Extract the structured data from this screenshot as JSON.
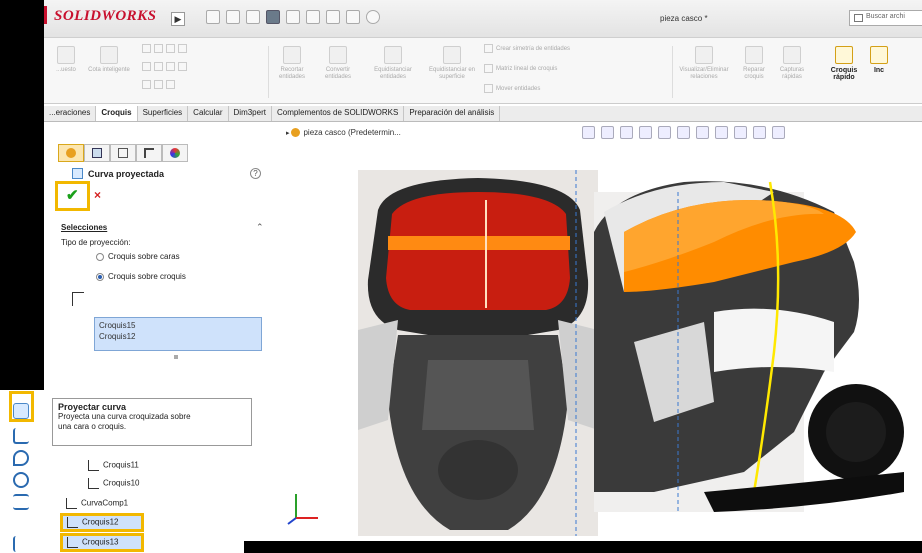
{
  "app": {
    "name": "SOLIDWORKS",
    "document_title": "pieza casco *",
    "search_placeholder": "Buscar archi"
  },
  "ribbon": {
    "buttons": [
      {
        "label": "...uesto"
      },
      {
        "label": "Cota inteligente"
      },
      {
        "label": "Recortar entidades"
      },
      {
        "label": "Convertir entidades"
      },
      {
        "label": "Equidistanciar entidades"
      },
      {
        "label": "Equidistanciar en superficie"
      },
      {
        "label": "Visualizar/Eliminar relaciones"
      },
      {
        "label": "Reparar croquis"
      },
      {
        "label": "Capturas rápidas"
      }
    ],
    "row_items": [
      "Crear simetría de entidades",
      "Matriz lineal de croquis",
      "Mover entidades"
    ],
    "active_button": {
      "line1": "Croquis",
      "line2": "rápido"
    },
    "cut_off_label": "Inc"
  },
  "tabs": [
    {
      "label": "...eraciones",
      "active": false
    },
    {
      "label": "Croquis",
      "active": true
    },
    {
      "label": "Superficies",
      "active": false
    },
    {
      "label": "Calcular",
      "active": false
    },
    {
      "label": "Dim3pert",
      "active": false
    },
    {
      "label": "Complementos de SOLIDWORKS",
      "active": false
    },
    {
      "label": "Preparación del análisis",
      "active": false
    }
  ],
  "property_manager": {
    "title": "Curva proyectada",
    "ok_symbol": "✔",
    "cancel_symbol": "×",
    "help_symbol": "?",
    "section": "Selecciones",
    "projection_label": "Tipo de proyección:",
    "options": [
      {
        "label": "Croquis sobre caras",
        "selected": false
      },
      {
        "label": "Croquis sobre croquis",
        "selected": true
      }
    ],
    "selections": [
      "Croquis15",
      "Croquis12"
    ]
  },
  "tooltip": {
    "title": "Proyectar curva",
    "description_line1": "Proyecta una curva croquizada sobre",
    "description_line2": "una cara o croquis."
  },
  "feature_tree": {
    "items": [
      {
        "label": "Croquis11",
        "highlighted": false
      },
      {
        "label": "Croquis10",
        "highlighted": false
      },
      {
        "label": "CurvaComp1",
        "highlighted": false
      },
      {
        "label": "Croquis12",
        "highlighted": true
      },
      {
        "label": "Croquis13",
        "highlighted": true
      }
    ]
  },
  "viewport": {
    "tree_label": "pieza casco  (Predetermin..."
  },
  "colors": {
    "highlight": "#f2b800",
    "brand": "#c8102e",
    "selection_fill": "#cfe2fb"
  }
}
